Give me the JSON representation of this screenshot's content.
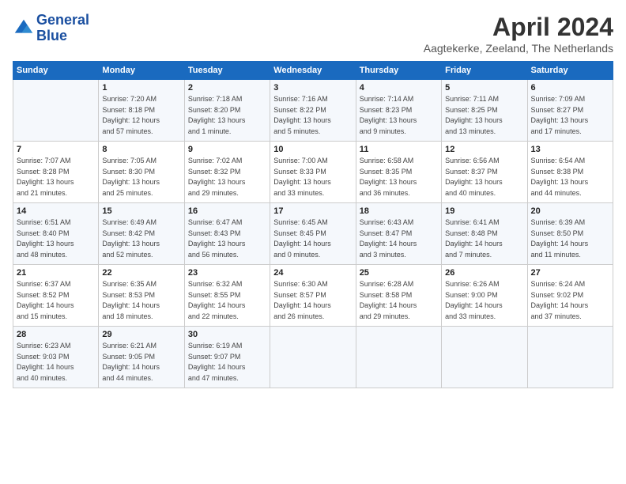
{
  "logo": {
    "line1": "General",
    "line2": "Blue"
  },
  "title": "April 2024",
  "subtitle": "Aagtekerke, Zeeland, The Netherlands",
  "days_of_week": [
    "Sunday",
    "Monday",
    "Tuesday",
    "Wednesday",
    "Thursday",
    "Friday",
    "Saturday"
  ],
  "weeks": [
    [
      {
        "num": "",
        "info": ""
      },
      {
        "num": "1",
        "info": "Sunrise: 7:20 AM\nSunset: 8:18 PM\nDaylight: 12 hours\nand 57 minutes."
      },
      {
        "num": "2",
        "info": "Sunrise: 7:18 AM\nSunset: 8:20 PM\nDaylight: 13 hours\nand 1 minute."
      },
      {
        "num": "3",
        "info": "Sunrise: 7:16 AM\nSunset: 8:22 PM\nDaylight: 13 hours\nand 5 minutes."
      },
      {
        "num": "4",
        "info": "Sunrise: 7:14 AM\nSunset: 8:23 PM\nDaylight: 13 hours\nand 9 minutes."
      },
      {
        "num": "5",
        "info": "Sunrise: 7:11 AM\nSunset: 8:25 PM\nDaylight: 13 hours\nand 13 minutes."
      },
      {
        "num": "6",
        "info": "Sunrise: 7:09 AM\nSunset: 8:27 PM\nDaylight: 13 hours\nand 17 minutes."
      }
    ],
    [
      {
        "num": "7",
        "info": "Sunrise: 7:07 AM\nSunset: 8:28 PM\nDaylight: 13 hours\nand 21 minutes."
      },
      {
        "num": "8",
        "info": "Sunrise: 7:05 AM\nSunset: 8:30 PM\nDaylight: 13 hours\nand 25 minutes."
      },
      {
        "num": "9",
        "info": "Sunrise: 7:02 AM\nSunset: 8:32 PM\nDaylight: 13 hours\nand 29 minutes."
      },
      {
        "num": "10",
        "info": "Sunrise: 7:00 AM\nSunset: 8:33 PM\nDaylight: 13 hours\nand 33 minutes."
      },
      {
        "num": "11",
        "info": "Sunrise: 6:58 AM\nSunset: 8:35 PM\nDaylight: 13 hours\nand 36 minutes."
      },
      {
        "num": "12",
        "info": "Sunrise: 6:56 AM\nSunset: 8:37 PM\nDaylight: 13 hours\nand 40 minutes."
      },
      {
        "num": "13",
        "info": "Sunrise: 6:54 AM\nSunset: 8:38 PM\nDaylight: 13 hours\nand 44 minutes."
      }
    ],
    [
      {
        "num": "14",
        "info": "Sunrise: 6:51 AM\nSunset: 8:40 PM\nDaylight: 13 hours\nand 48 minutes."
      },
      {
        "num": "15",
        "info": "Sunrise: 6:49 AM\nSunset: 8:42 PM\nDaylight: 13 hours\nand 52 minutes."
      },
      {
        "num": "16",
        "info": "Sunrise: 6:47 AM\nSunset: 8:43 PM\nDaylight: 13 hours\nand 56 minutes."
      },
      {
        "num": "17",
        "info": "Sunrise: 6:45 AM\nSunset: 8:45 PM\nDaylight: 14 hours\nand 0 minutes."
      },
      {
        "num": "18",
        "info": "Sunrise: 6:43 AM\nSunset: 8:47 PM\nDaylight: 14 hours\nand 3 minutes."
      },
      {
        "num": "19",
        "info": "Sunrise: 6:41 AM\nSunset: 8:48 PM\nDaylight: 14 hours\nand 7 minutes."
      },
      {
        "num": "20",
        "info": "Sunrise: 6:39 AM\nSunset: 8:50 PM\nDaylight: 14 hours\nand 11 minutes."
      }
    ],
    [
      {
        "num": "21",
        "info": "Sunrise: 6:37 AM\nSunset: 8:52 PM\nDaylight: 14 hours\nand 15 minutes."
      },
      {
        "num": "22",
        "info": "Sunrise: 6:35 AM\nSunset: 8:53 PM\nDaylight: 14 hours\nand 18 minutes."
      },
      {
        "num": "23",
        "info": "Sunrise: 6:32 AM\nSunset: 8:55 PM\nDaylight: 14 hours\nand 22 minutes."
      },
      {
        "num": "24",
        "info": "Sunrise: 6:30 AM\nSunset: 8:57 PM\nDaylight: 14 hours\nand 26 minutes."
      },
      {
        "num": "25",
        "info": "Sunrise: 6:28 AM\nSunset: 8:58 PM\nDaylight: 14 hours\nand 29 minutes."
      },
      {
        "num": "26",
        "info": "Sunrise: 6:26 AM\nSunset: 9:00 PM\nDaylight: 14 hours\nand 33 minutes."
      },
      {
        "num": "27",
        "info": "Sunrise: 6:24 AM\nSunset: 9:02 PM\nDaylight: 14 hours\nand 37 minutes."
      }
    ],
    [
      {
        "num": "28",
        "info": "Sunrise: 6:23 AM\nSunset: 9:03 PM\nDaylight: 14 hours\nand 40 minutes."
      },
      {
        "num": "29",
        "info": "Sunrise: 6:21 AM\nSunset: 9:05 PM\nDaylight: 14 hours\nand 44 minutes."
      },
      {
        "num": "30",
        "info": "Sunrise: 6:19 AM\nSunset: 9:07 PM\nDaylight: 14 hours\nand 47 minutes."
      },
      {
        "num": "",
        "info": ""
      },
      {
        "num": "",
        "info": ""
      },
      {
        "num": "",
        "info": ""
      },
      {
        "num": "",
        "info": ""
      }
    ]
  ]
}
